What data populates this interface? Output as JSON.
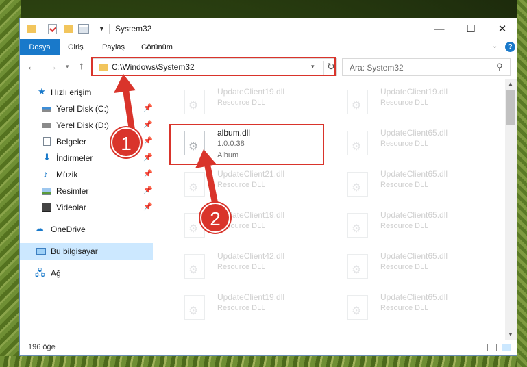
{
  "window": {
    "title": "System32",
    "controls": {
      "minimize": "—",
      "maximize": "☐",
      "close": "✕"
    }
  },
  "ribbon": {
    "tabs": [
      "Dosya",
      "Giriş",
      "Paylaş",
      "Görünüm"
    ],
    "help": "?"
  },
  "nav": {
    "address": "C:\\Windows\\System32",
    "search_placeholder": "Ara: System32"
  },
  "sidebar": {
    "items": [
      {
        "label": "Hızlı erişim",
        "icon": "quick-access-star-icon"
      },
      {
        "label": "Yerel Disk (C:)",
        "icon": "local-disk-icon",
        "pinned": true
      },
      {
        "label": "Yerel Disk (D:)",
        "icon": "local-disk-icon",
        "pinned": true
      },
      {
        "label": "Belgeler",
        "icon": "documents-icon",
        "pinned": true
      },
      {
        "label": "İndirmeler",
        "icon": "downloads-icon",
        "pinned": true
      },
      {
        "label": "Müzik",
        "icon": "music-icon",
        "pinned": true
      },
      {
        "label": "Resimler",
        "icon": "pictures-icon",
        "pinned": true
      },
      {
        "label": "Videolar",
        "icon": "videos-icon",
        "pinned": true
      },
      {
        "label": "OneDrive",
        "icon": "onedrive-cloud-icon"
      },
      {
        "label": "Bu bilgisayar",
        "icon": "this-pc-icon",
        "selected": true
      },
      {
        "label": "Ağ",
        "icon": "network-icon"
      }
    ]
  },
  "files": {
    "left_column": [
      {
        "name": "UpdateClient19.dll",
        "desc": "Resource DLL"
      },
      {
        "name": "album.dll",
        "version": "1.0.0.38",
        "type": "Album",
        "selected": true
      },
      {
        "name": "UpdateClient21.dll",
        "desc": "Resource DLL"
      },
      {
        "name": "UpdateClient19.dll",
        "desc": "Resource DLL"
      },
      {
        "name": "UpdateClient42.dll",
        "desc": "Resource DLL"
      },
      {
        "name": "UpdateClient19.dll",
        "desc": "Resource DLL"
      }
    ],
    "right_column": [
      {
        "name": "UpdateClient19.dll",
        "desc": "Resource DLL"
      },
      {
        "name": "UpdateClient65.dll",
        "desc": "Resource DLL"
      },
      {
        "name": "UpdateClient65.dll",
        "desc": "Resource DLL"
      },
      {
        "name": "UpdateClient65.dll",
        "desc": "Resource DLL"
      },
      {
        "name": "UpdateClient65.dll",
        "desc": "Resource DLL"
      },
      {
        "name": "UpdateClient65.dll",
        "desc": "Resource DLL"
      }
    ]
  },
  "status": {
    "count": "196 öğe"
  },
  "callouts": {
    "one": "1",
    "two": "2"
  },
  "colors": {
    "accent": "#1979ca",
    "highlight": "#d9342b",
    "selection": "#cce8ff"
  }
}
